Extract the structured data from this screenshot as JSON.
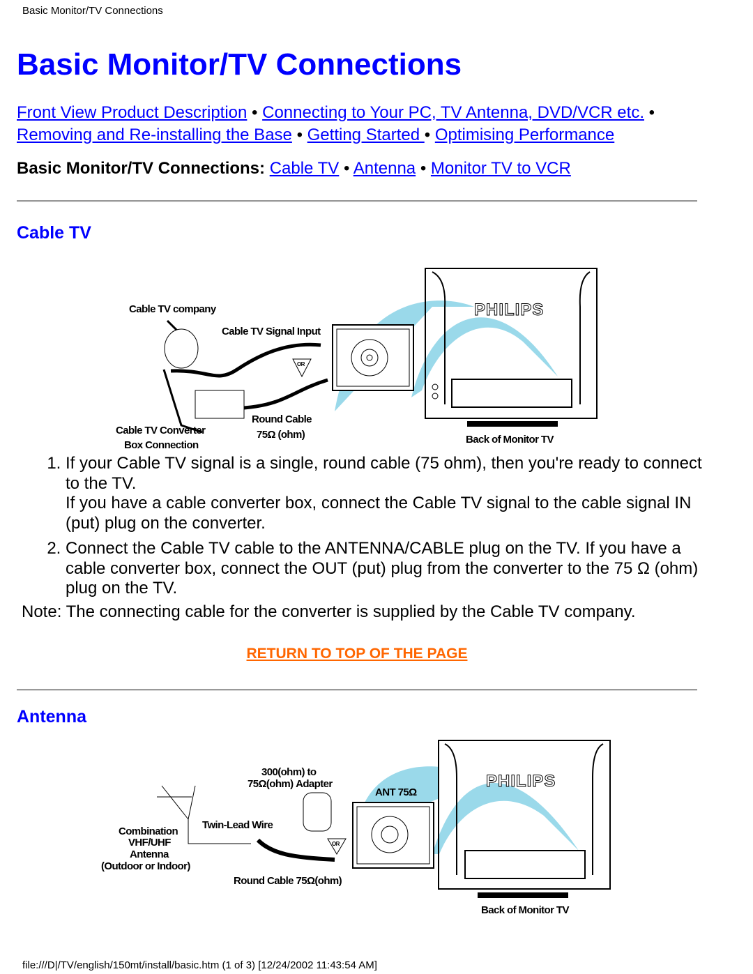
{
  "header": {
    "title": "Basic Monitor/TV Connections"
  },
  "page_title": "Basic Monitor/TV Connections",
  "nav_links": [
    "Front View Product Description",
    "Connecting to Your PC, TV Antenna, DVD/VCR etc.",
    "Removing and Re-installing the Base",
    "Getting Started ",
    "Optimising Performance"
  ],
  "separator": "•",
  "subnav": {
    "label": "Basic Monitor/TV Connections:",
    "links": [
      "Cable TV",
      "Antenna",
      "Monitor TV to VCR"
    ]
  },
  "cable_tv": {
    "heading": "Cable TV",
    "diagram": {
      "company": "Cable TV company",
      "signal_input": "Cable TV Signal Input",
      "or": "OR",
      "converter_1": "Cable TV Converter",
      "converter_2": "Box Connection",
      "round_cable_1": "Round Cable",
      "round_cable_2": "75Ω (ohm)",
      "brand": "PHILIPS",
      "back": "Back of  Monitor TV"
    },
    "steps": [
      {
        "line1": "If your Cable TV signal is a single, round cable (75 ohm), then you're ready to connect to the TV.",
        "line2": "If you have a cable converter box, connect the Cable TV signal to the cable signal IN (put) plug on the converter."
      },
      {
        "line1": "Connect the Cable TV cable to the ANTENNA/CABLE plug on the TV. If you have a cable converter box, connect the OUT (put) plug from the converter to the 75 Ω (ohm) plug on the TV."
      }
    ],
    "note": "Note: The connecting cable for the converter is supplied by the Cable TV company."
  },
  "return_link": "RETURN TO TOP OF THE PAGE",
  "antenna": {
    "heading": "Antenna",
    "diagram": {
      "adapter_1": "300(ohm) to",
      "adapter_2": "75Ω(ohm) Adapter",
      "ant": "ANT 75Ω",
      "twin_lead": "Twin-Lead Wire",
      "combo_1": "Combination",
      "combo_2": "VHF/UHF",
      "combo_3": "Antenna",
      "combo_4": "(Outdoor or Indoor)",
      "or": "OR",
      "round_cable": "Round Cable 75Ω(ohm)",
      "brand": "PHILIPS",
      "back": "Back of  Monitor TV"
    }
  },
  "colors": {
    "link": "#0000ff",
    "return_link": "#ff6600",
    "highlight": "#9ad9ea"
  },
  "footer": "file:///D|/TV/english/150mt/install/basic.htm (1 of 3) [12/24/2002 11:43:54 AM]"
}
